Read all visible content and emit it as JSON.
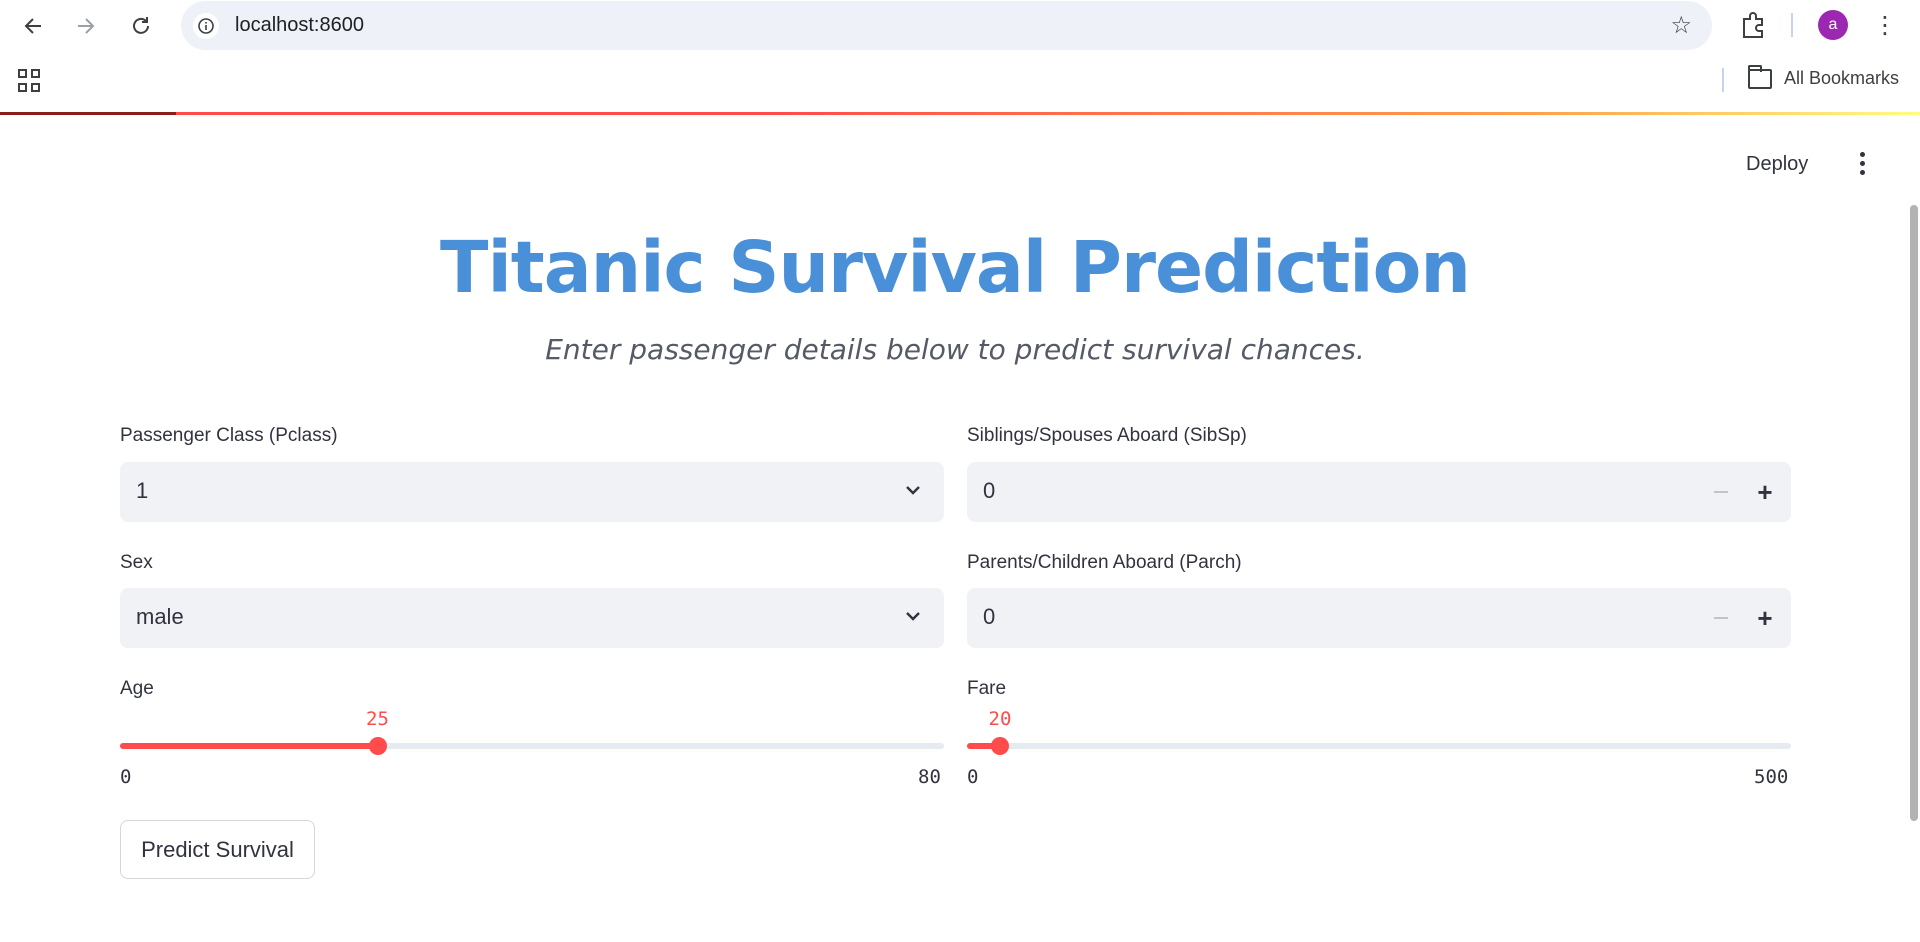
{
  "browser": {
    "url": "localhost:8600",
    "avatar_letter": "a",
    "bookmarks_label": "All Bookmarks",
    "icons": [
      "back-icon",
      "forward-icon",
      "reload-icon",
      "info-icon",
      "star-icon",
      "extensions-icon",
      "apps-icon",
      "folder-icon"
    ]
  },
  "app": {
    "deploy_label": "Deploy",
    "title": "Titanic Survival Prediction",
    "subtitle": "Enter passenger details below to predict survival chances.",
    "accent_color": "#ff4b4b",
    "title_color": "#4a90d9",
    "pclass": {
      "label": "Passenger Class (Pclass)",
      "value": "1"
    },
    "sex": {
      "label": "Sex",
      "value": "male"
    },
    "sibsp": {
      "label": "Siblings/Spouses Aboard (SibSp)",
      "value": "0"
    },
    "parch": {
      "label": "Parents/Children Aboard (Parch)",
      "value": "0"
    },
    "age": {
      "label": "Age",
      "value": 25,
      "min": 0,
      "max": 80
    },
    "fare": {
      "label": "Fare",
      "value": 20,
      "min": 0,
      "max": 500
    },
    "predict_label": "Predict Survival"
  }
}
